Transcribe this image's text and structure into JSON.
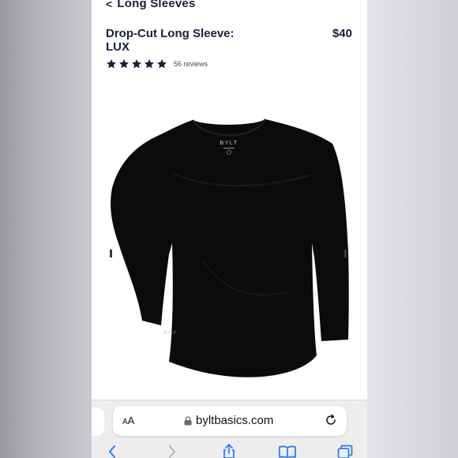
{
  "nav": {
    "back_label": "Long Sleeves"
  },
  "product": {
    "title": "Drop-Cut Long Sleeve: LUX",
    "price": "$40",
    "rating_stars": 5,
    "reviews_text": "56 reviews",
    "garment_color": "#0b0b0b",
    "image_brand_text": "BYLT"
  },
  "browser": {
    "text_size_button": "AA",
    "url": "bylt",
    "url_domain": "bylt basics.com",
    "url_full": "byltbasics.com",
    "toolbar_icons": [
      "back-icon",
      "forward-icon",
      "share-icon",
      "bookmarks-icon",
      "tabs-icon"
    ],
    "accent_color": "#2f7bf6"
  },
  "colors": {
    "text_primary": "#1b1f3b",
    "star_color": "#1b1f3b",
    "page_bg": "#ffffff",
    "chrome_bg": "#ededee"
  }
}
